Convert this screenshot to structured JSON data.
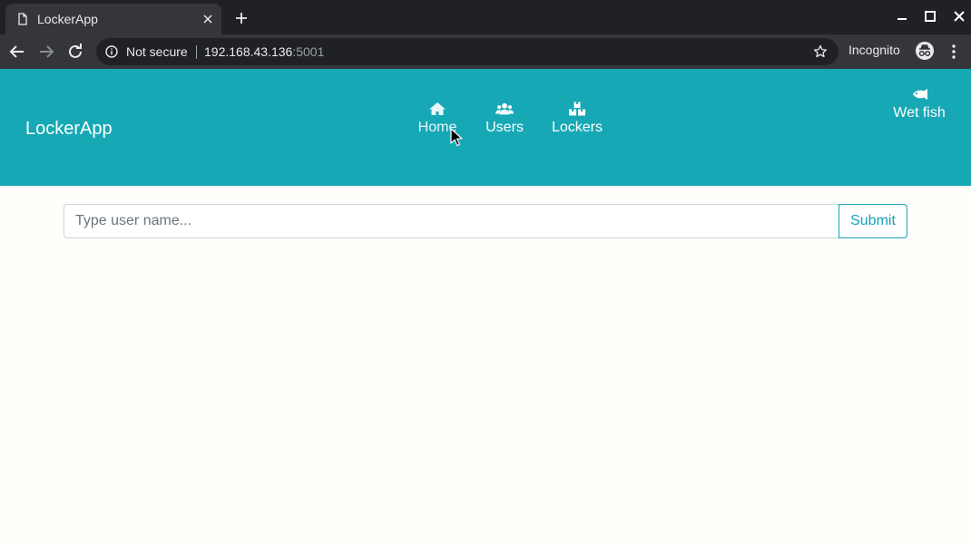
{
  "browser": {
    "tab_title": "LockerApp",
    "security_label": "Not secure",
    "url_host": "192.168.43.136",
    "url_port": ":5001",
    "incognito_label": "Incognito"
  },
  "navbar": {
    "brand": "LockerApp",
    "links": [
      {
        "label": "Home",
        "icon": "home-icon"
      },
      {
        "label": "Users",
        "icon": "users-icon"
      },
      {
        "label": "Lockers",
        "icon": "boxes-icon"
      }
    ],
    "user": {
      "label": "Wet fish",
      "icon": "fish-icon"
    },
    "background_color": "#17a8b5"
  },
  "form": {
    "input_placeholder": "Type user name...",
    "input_value": "",
    "submit_label": "Submit",
    "accent_color": "#17a2b8"
  }
}
